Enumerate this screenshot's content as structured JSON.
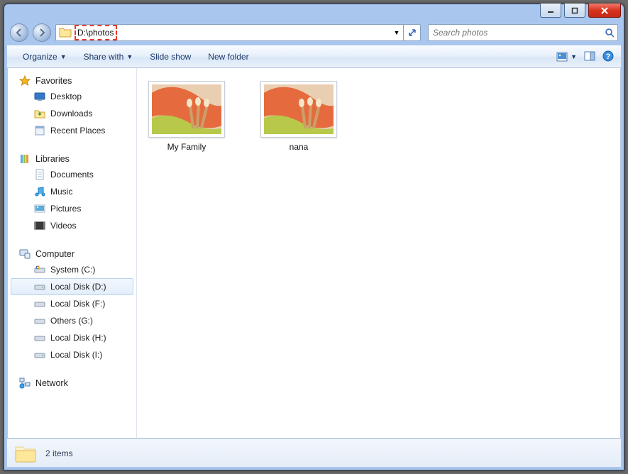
{
  "address_path": "D:\\photos",
  "search": {
    "placeholder": "Search photos"
  },
  "toolbar": {
    "organize": "Organize",
    "share_with": "Share with",
    "slide_show": "Slide show",
    "new_folder": "New folder"
  },
  "sidebar": {
    "favorites": {
      "label": "Favorites",
      "items": [
        "Desktop",
        "Downloads",
        "Recent Places"
      ]
    },
    "libraries": {
      "label": "Libraries",
      "items": [
        "Documents",
        "Music",
        "Pictures",
        "Videos"
      ]
    },
    "computer": {
      "label": "Computer",
      "items": [
        "System (C:)",
        "Local Disk (D:)",
        "Local Disk (F:)",
        "Others (G:)",
        "Local Disk (H:)",
        "Local Disk (I:)"
      ],
      "selected_index": 1
    },
    "network": {
      "label": "Network"
    }
  },
  "files": [
    {
      "label": "My Family"
    },
    {
      "label": "nana"
    }
  ],
  "status_text": "2 items"
}
